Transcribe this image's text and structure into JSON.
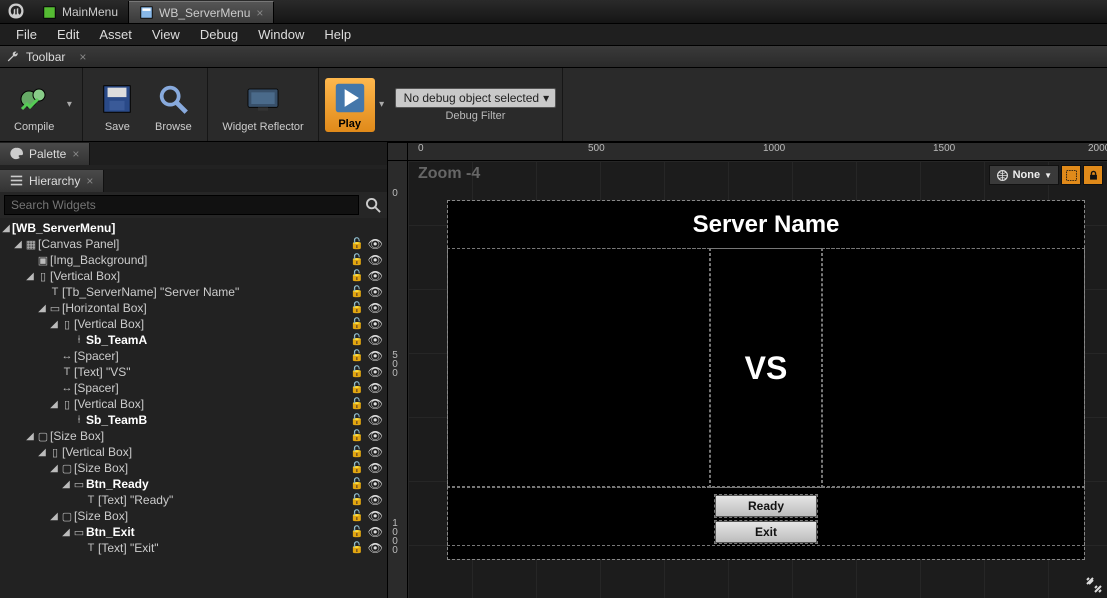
{
  "tabs": {
    "main": "MainMenu",
    "second": "WB_ServerMenu"
  },
  "menu": {
    "file": "File",
    "edit": "Edit",
    "asset": "Asset",
    "view": "View",
    "debug": "Debug",
    "window": "Window",
    "help": "Help"
  },
  "toolbar": {
    "title": "Toolbar",
    "compile": "Compile",
    "save": "Save",
    "browse": "Browse",
    "reflector": "Widget Reflector",
    "play": "Play",
    "debug_select": "No debug object selected",
    "debug_label": "Debug Filter"
  },
  "panels": {
    "palette": "Palette",
    "hierarchy": "Hierarchy"
  },
  "search": {
    "placeholder": "Search Widgets"
  },
  "tree": {
    "r0": "[WB_ServerMenu]",
    "r1": "[Canvas Panel]",
    "r2": "[Img_Background]",
    "r3": "[Vertical Box]",
    "r4": "[Tb_ServerName] \"Server Name\"",
    "r5": "[Horizontal Box]",
    "r6": "[Vertical Box]",
    "r7": "Sb_TeamA",
    "r8": "[Spacer]",
    "r9": "[Text] \"VS\"",
    "r10": "[Spacer]",
    "r11": "[Vertical Box]",
    "r12": "Sb_TeamB",
    "r13": "[Size Box]",
    "r14": "[Vertical Box]",
    "r15": "[Size Box]",
    "r16": "Btn_Ready",
    "r17": "[Text] \"Ready\"",
    "r18": "[Size Box]",
    "r19": "Btn_Exit",
    "r20": "[Text] \"Exit\""
  },
  "viewport": {
    "zoom": "Zoom -4",
    "overlay_none": "None",
    "ruler_h": {
      "t0": "0",
      "t500": "500",
      "t1000": "1000",
      "t1500": "1500",
      "t2000": "2000"
    },
    "ruler_v": {
      "t0": "0",
      "t500": "500",
      "t1000": "1000"
    }
  },
  "game": {
    "server_name": "Server Name",
    "vs": "VS",
    "ready": "Ready",
    "exit": "Exit"
  }
}
